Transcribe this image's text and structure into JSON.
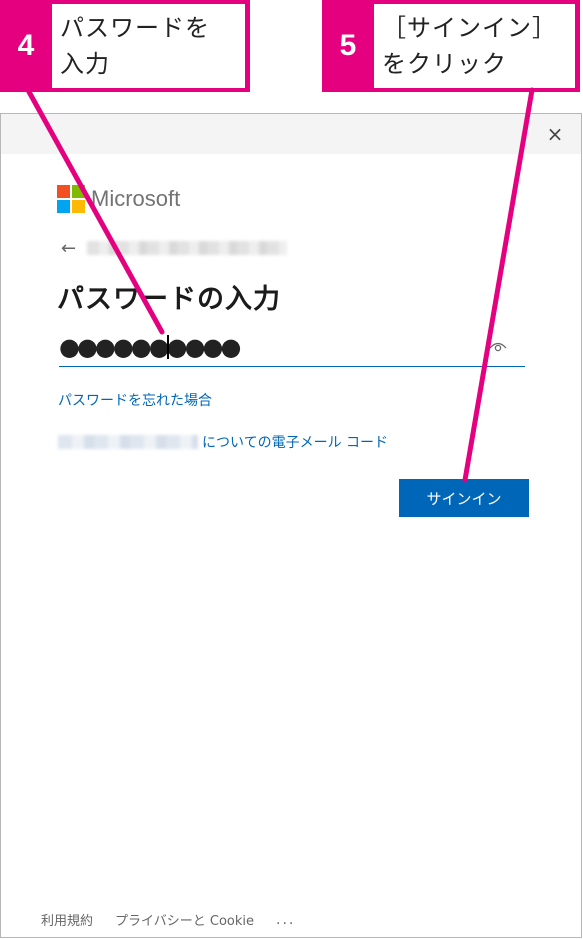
{
  "callouts": {
    "step4": {
      "number": "4",
      "text": "パスワードを\n入力"
    },
    "step5": {
      "number": "5",
      "text": "［サインイン］\nをクリック"
    }
  },
  "dialog": {
    "close_icon": "×",
    "logo_text": "Microsoft",
    "back_icon": "←",
    "title": "パスワードの入力",
    "password_value": "●●●●●●●●●●",
    "forgot_password_link": "パスワードを忘れた場合",
    "email_code_link": "についての電子メール コード",
    "signin_button": "サインイン"
  },
  "footer": {
    "terms": "利用規約",
    "privacy": "プライバシーと Cookie",
    "more": "..."
  },
  "colors": {
    "accent_pink": "#e4007f",
    "microsoft_blue": "#0067b8"
  },
  "icons": [
    "close-icon",
    "back-arrow-icon",
    "eye-icon",
    "microsoft-logo-icon"
  ]
}
